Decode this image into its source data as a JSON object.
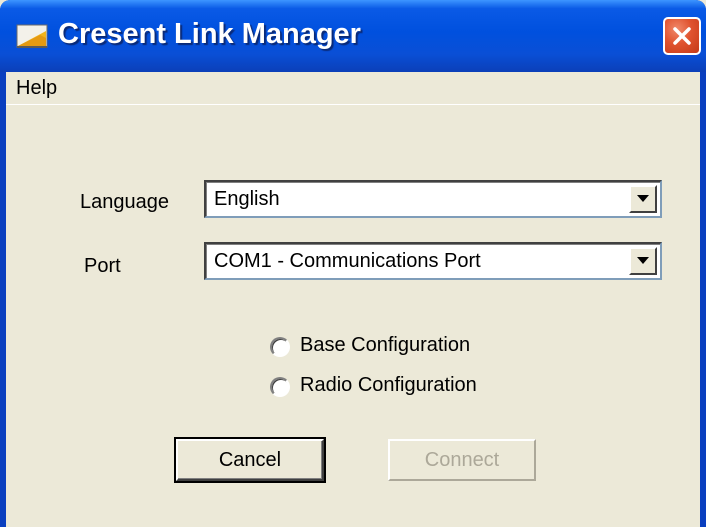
{
  "window": {
    "title": "Cresent Link Manager"
  },
  "menu": {
    "items": [
      {
        "label": "Help"
      }
    ]
  },
  "form": {
    "language": {
      "label": "Language",
      "value": "English"
    },
    "port": {
      "label": "Port",
      "value": "COM1 - Communications Port"
    },
    "options": [
      {
        "label": "Base Configuration",
        "selected": false
      },
      {
        "label": "Radio Configuration",
        "selected": false
      }
    ]
  },
  "buttons": {
    "cancel_label": "Cancel",
    "connect_label": "Connect"
  },
  "icons": {
    "app": "app-window-icon",
    "close": "close-icon",
    "dropdown": "chevron-down-icon"
  },
  "colors": {
    "titlebar": "#0050de",
    "client_background": "#ece9d8",
    "close_button": "#e0532f",
    "disabled_text": "#aca899"
  }
}
